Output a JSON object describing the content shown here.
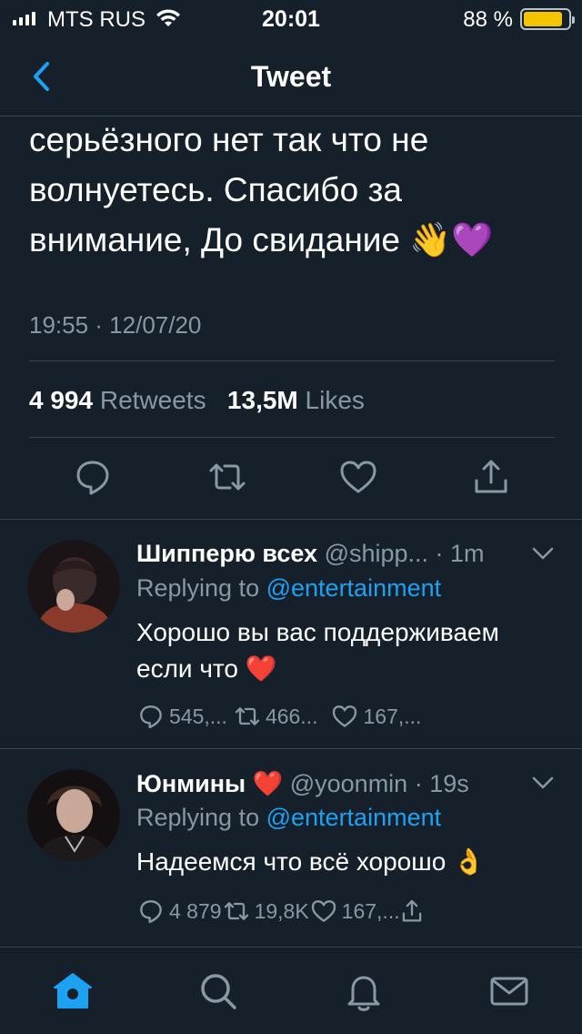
{
  "status_bar": {
    "carrier": "MTS RUS",
    "time": "20:01",
    "battery_percent": "88 %",
    "battery_level": 0.88,
    "battery_color": "#f5c400"
  },
  "nav": {
    "back_icon": "chevron-left-icon",
    "title": "Tweet"
  },
  "tweet": {
    "text_lines": [
      "серьёзного нет так что не",
      "волнуетесь. Спасибо за",
      "внимание, До свидание 👋💜"
    ],
    "timestamp": "19:55 · 12/07/20",
    "retweets_count": "4 994",
    "retweets_label": "Retweets",
    "likes_count": "13,5M",
    "likes_label": "Likes",
    "actions": [
      "reply-icon",
      "retweet-icon",
      "like-icon",
      "share-icon"
    ]
  },
  "replies": [
    {
      "name": "Шипперю всех",
      "handle": "@shipp...",
      "time": "· 1m",
      "replying_to_label": "Replying to",
      "replying_to_mention": "@entertainment",
      "text_lines": [
        "Хорошо вы вас поддерживаем",
        "если что ❤️"
      ],
      "reply_count": "545,...",
      "retweet_count": "466...",
      "like_count": "167,..."
    },
    {
      "name": "Юнмины ❤️",
      "handle": "@yoonmin",
      "time": "· 19s",
      "replying_to_label": "Replying to",
      "replying_to_mention": "@entertainment",
      "text_lines": [
        "Надеемся что всё хорошо 👌"
      ],
      "reply_count": "4 879",
      "retweet_count": "19,8K",
      "like_count": "167,..."
    }
  ],
  "tab_bar": [
    "home-icon",
    "search-icon",
    "notifications-icon",
    "messages-icon"
  ],
  "colors": {
    "background": "#15202b",
    "accent": "#1da1f2",
    "secondary_text": "#8899a6",
    "divider": "#38444d"
  }
}
